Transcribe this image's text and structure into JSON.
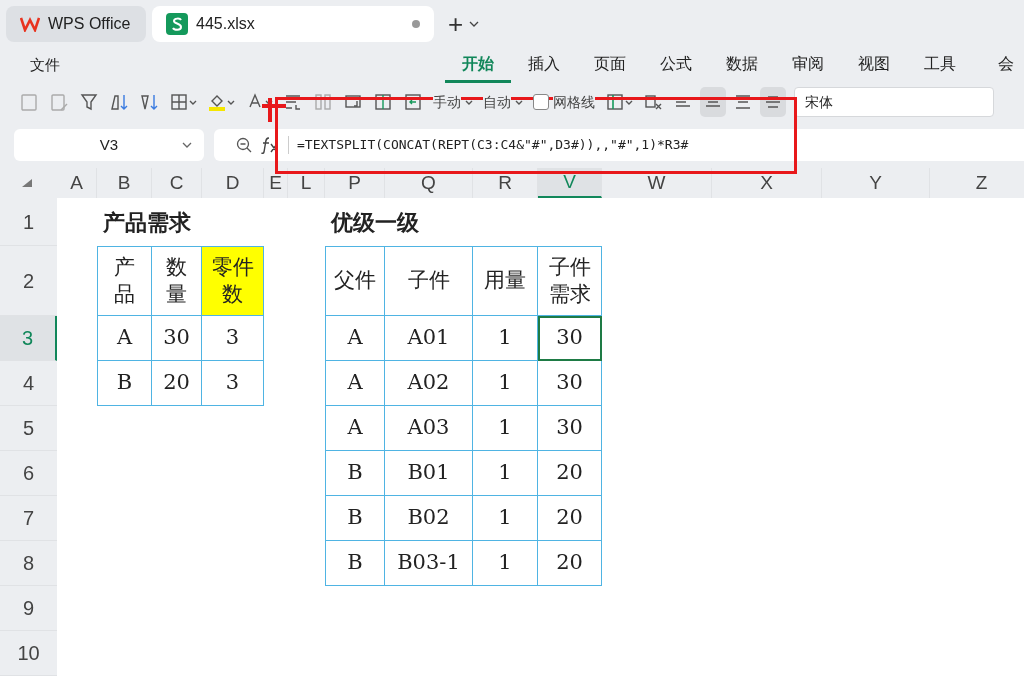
{
  "app_tabs": [
    {
      "label": "WPS Office",
      "selected": false,
      "modified": false
    },
    {
      "label": "445.xlsx",
      "selected": true,
      "modified": true
    }
  ],
  "new_tab": "+",
  "menu": {
    "file": "文件"
  },
  "ribbon_tabs": [
    {
      "label": "开始",
      "selected": true
    },
    {
      "label": "插入",
      "selected": false
    },
    {
      "label": "页面",
      "selected": false
    },
    {
      "label": "公式",
      "selected": false
    },
    {
      "label": "数据",
      "selected": false
    },
    {
      "label": "审阅",
      "selected": false
    },
    {
      "label": "视图",
      "selected": false
    },
    {
      "label": "工具",
      "selected": false
    },
    {
      "label": "会",
      "selected": false
    }
  ],
  "toolbar": {
    "row_height": "手动",
    "column_width": "自动",
    "gridlines": {
      "label": "网格线",
      "checked": false
    },
    "align": [
      {
        "selected": false
      },
      {
        "selected": true
      },
      {
        "selected": false
      },
      {
        "selected": true
      }
    ],
    "font": "宋体"
  },
  "formula_bar": {
    "name_box": "V3",
    "formula": "=TEXTSPLIT(CONCAT(REPT(C3:C4&\"#\",D3#)),,\"#\",1)*R3#"
  },
  "sheet": {
    "columns": [
      {
        "label": "A",
        "selected": false
      },
      {
        "label": "B",
        "selected": false
      },
      {
        "label": "C",
        "selected": false
      },
      {
        "label": "D",
        "selected": false
      },
      {
        "label": "E",
        "selected": false
      },
      {
        "label": "L",
        "selected": false
      },
      {
        "label": "P",
        "selected": false
      },
      {
        "label": "Q",
        "selected": false
      },
      {
        "label": "R",
        "selected": false
      },
      {
        "label": "V",
        "selected": true
      },
      {
        "label": "W",
        "selected": false
      },
      {
        "label": "X",
        "selected": false
      },
      {
        "label": "Y",
        "selected": false
      },
      {
        "label": "Z",
        "selected": false
      }
    ],
    "rows": [
      {
        "label": "1",
        "selected": false
      },
      {
        "label": "2",
        "selected": false
      },
      {
        "label": "3",
        "selected": true
      },
      {
        "label": "4",
        "selected": false
      },
      {
        "label": "5",
        "selected": false
      },
      {
        "label": "6",
        "selected": false
      },
      {
        "label": "7",
        "selected": false
      },
      {
        "label": "8",
        "selected": false
      },
      {
        "label": "9",
        "selected": false
      },
      {
        "label": "10",
        "selected": false
      }
    ],
    "tables": [
      {
        "title": "产品需求",
        "header": [
          {
            "text": "产品",
            "highlighted": false
          },
          {
            "text": "数量",
            "highlighted": false
          },
          {
            "text": "零件数",
            "highlighted": true
          }
        ],
        "rows": [
          [
            {
              "text": "A",
              "selected": false
            },
            {
              "text": "30",
              "selected": false
            },
            {
              "text": "3",
              "selected": false
            }
          ],
          [
            {
              "text": "B",
              "selected": false
            },
            {
              "text": "20",
              "selected": false
            },
            {
              "text": "3",
              "selected": false
            }
          ]
        ]
      },
      {
        "title": "优级一级",
        "header": [
          {
            "text": "父件",
            "highlighted": false
          },
          {
            "text": "子件",
            "highlighted": false
          },
          {
            "text": "用量",
            "highlighted": false
          },
          {
            "text": "子件需求",
            "highlighted": false
          }
        ],
        "rows": [
          [
            {
              "text": "A",
              "selected": false
            },
            {
              "text": "A01",
              "selected": false
            },
            {
              "text": "1",
              "selected": false
            },
            {
              "text": "30",
              "selected": true
            }
          ],
          [
            {
              "text": "A",
              "selected": false
            },
            {
              "text": "A02",
              "selected": false
            },
            {
              "text": "1",
              "selected": false
            },
            {
              "text": "30",
              "selected": false
            }
          ],
          [
            {
              "text": "A",
              "selected": false
            },
            {
              "text": "A03",
              "selected": false
            },
            {
              "text": "1",
              "selected": false
            },
            {
              "text": "30",
              "selected": false
            }
          ],
          [
            {
              "text": "B",
              "selected": false
            },
            {
              "text": "B01",
              "selected": false
            },
            {
              "text": "1",
              "selected": false
            },
            {
              "text": "20",
              "selected": false
            }
          ],
          [
            {
              "text": "B",
              "selected": false
            },
            {
              "text": "B02",
              "selected": false
            },
            {
              "text": "1",
              "selected": false
            },
            {
              "text": "20",
              "selected": false
            }
          ],
          [
            {
              "text": "B",
              "selected": false
            },
            {
              "text": "B03-1",
              "selected": false
            },
            {
              "text": "1",
              "selected": false
            },
            {
              "text": "20",
              "selected": false
            }
          ]
        ]
      }
    ]
  }
}
